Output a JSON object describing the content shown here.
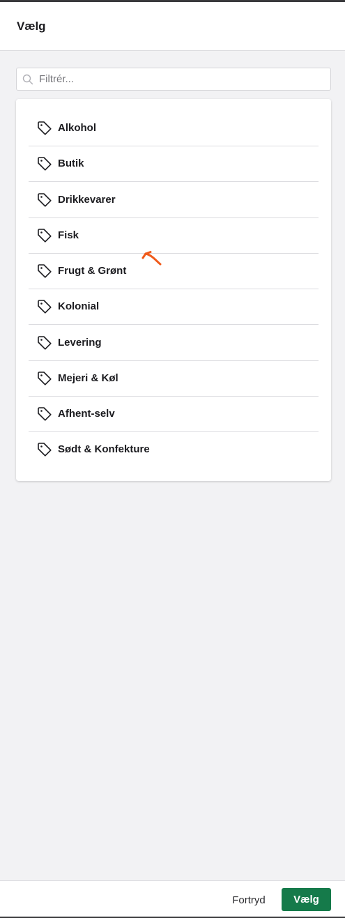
{
  "dialog": {
    "title": "Vælg"
  },
  "search": {
    "placeholder": "Filtrér...",
    "value": "",
    "icon": "search-icon"
  },
  "list": {
    "item_icon": "tag-icon",
    "items": [
      {
        "label": "Alkohol"
      },
      {
        "label": "Butik"
      },
      {
        "label": "Drikkevarer"
      },
      {
        "label": "Fisk"
      },
      {
        "label": "Frugt & Grønt"
      },
      {
        "label": "Kolonial"
      },
      {
        "label": "Levering"
      },
      {
        "label": "Mejeri & Køl"
      },
      {
        "label": "Afhent-selv"
      },
      {
        "label": "Sødt & Konfekture"
      }
    ]
  },
  "footer": {
    "cancel_label": "Fortryd",
    "confirm_label": "Vælg"
  },
  "colors": {
    "accent": "#157a4a",
    "background": "#f2f2f4",
    "annotation": "#f05a1a"
  }
}
